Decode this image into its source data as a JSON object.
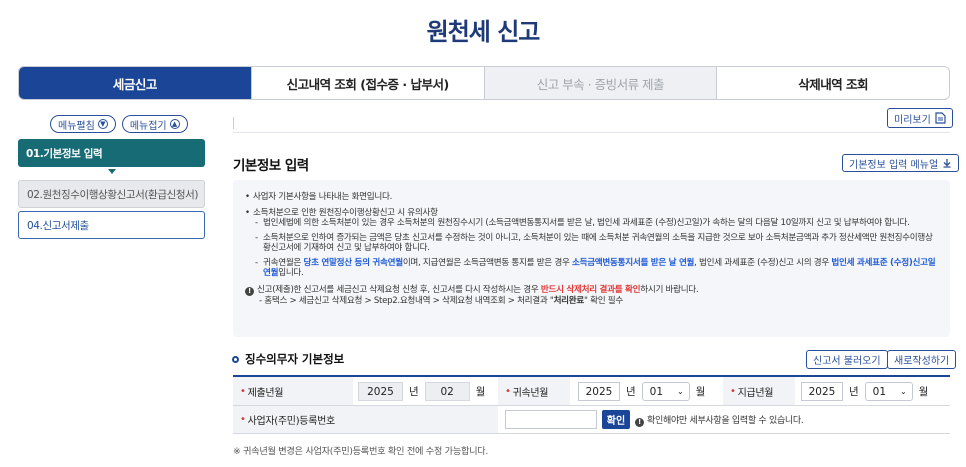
{
  "page_title": "원천세 신고",
  "tabs": [
    {
      "label": "세금신고",
      "state": "active"
    },
    {
      "label": "신고내역 조회 (접수증 · 납부서)",
      "state": "normal"
    },
    {
      "label": "신고 부속 · 증빙서류 제출",
      "state": "disabled"
    },
    {
      "label": "삭제내역 조회",
      "state": "normal"
    }
  ],
  "menu": {
    "expand_label": "메뉴펼침",
    "collapse_label": "메뉴접기"
  },
  "steps": [
    "01.기본정보 입력",
    "02.원천징수이행상황신고서(환급신청서)",
    "04.신고서제출"
  ],
  "preview_label": "미리보기",
  "section_title": "기본정보 입력",
  "manual_label": "기본정보 입력 메뉴얼",
  "info": {
    "b1": "사업자 기본사항을 나타내는 화면입니다.",
    "b2": "소득처분으로 인한 원천징수이행상황신고 시 유의사항",
    "s1": "법인세법에 의한 소득처분이 있는 경우 소득처분의 원천징수시기 (소득금액변동통지서를 받은 날, 법인세 과세표준 (수정)신고일)가 속하는 달의 다음달 10일까지 신고 및 납부하여야 합니다.",
    "s2": "소득처분으로 인하여 증가되는 금액은 당초 신고서를 수정하는 것이 아니고, 소득처분이 있는 때에 소득처분 귀속연월의 소득을 지급한 것으로 보아 소득처분금액과 추가 정산세액만 원천징수이행상황신고서에 기재하여 신고 및 납부하여야 합니다.",
    "s3a": "귀속연월은 ",
    "s3b": "당초 연말정산 등의 귀속연월",
    "s3c": "이며, 지급연월은 소득금액변동 통지를 받은 경우 ",
    "s3d": "소득금액변동통지서를 받은 날 연월",
    "s3e": ", 법인세 과세표준 (수정)신고 시의 경우 ",
    "s3f": "법인세 과세표준 (수정)신고일 연월",
    "s3g": "입니다.",
    "n1a": "신고(제출)한 신고서를 세금신고 삭제요청 신청 후, 신고서를 다시 작성하시는 경우 ",
    "n1b": "반드시 삭제처리 결과를 확인",
    "n1c": "하시기 바랍니다.",
    "n2a": "- 홈택스 > 세금신고 삭제요청 > Step2.요청내역 > 삭제요청 내역조회 > 처리결과 \"",
    "n2b": "처리완료",
    "n2c": "\" 확인 필수"
  },
  "sec2_title": "징수의무자 기본정보",
  "load_label": "신고서 불러오기",
  "new_label": "새로작성하기",
  "form": {
    "submit_label": "제출년월",
    "submit_year": "2025",
    "submit_month": "02",
    "belong_label": "귀속년월",
    "belong_year": "2025",
    "belong_month": "01",
    "pay_label": "지급년월",
    "pay_year": "2025",
    "pay_month": "01",
    "year_unit": "년",
    "month_unit": "월",
    "bizno_label": "사업자(주민)등록번호",
    "bizno_value": "",
    "confirm_label": "확인",
    "confirm_hint": "확인해야만 세부사항을 입력할 수 있습니다."
  },
  "footnote": "※ 귀속년월 변경은 사업자(주민)등록번호 확인 전에 수정 가능합니다."
}
